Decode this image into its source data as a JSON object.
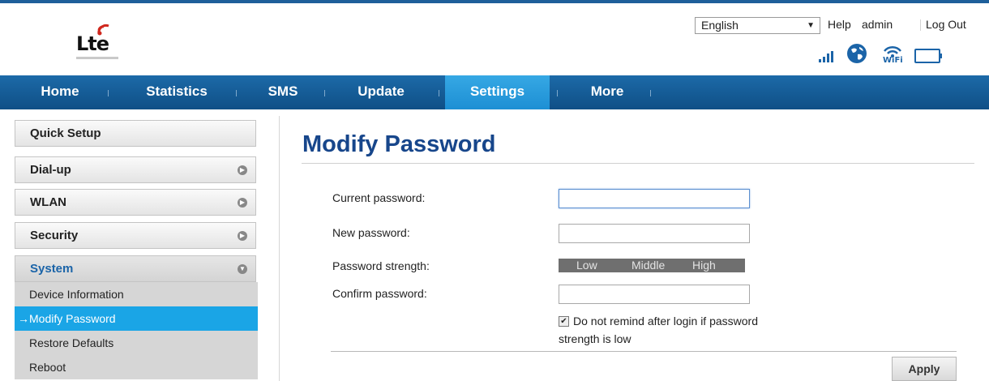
{
  "brand": {
    "logo_text": "Lte",
    "colors": {
      "nav": "#1a62a3",
      "accent": "#1aa5e6",
      "title": "#17468b"
    }
  },
  "header": {
    "language": {
      "selected": "English"
    },
    "links": {
      "help": "Help",
      "user": "admin",
      "logout": "Log Out"
    },
    "status_icons": [
      "signal-strength-icon",
      "globe-icon",
      "wifi-icon",
      "battery-icon"
    ],
    "wifi_label": "WiFi"
  },
  "nav": {
    "items": [
      {
        "label": "Home",
        "active": false
      },
      {
        "label": "Statistics",
        "active": false
      },
      {
        "label": "SMS",
        "active": false
      },
      {
        "label": "Update",
        "active": false
      },
      {
        "label": "Settings",
        "active": true
      },
      {
        "label": "More",
        "active": false
      }
    ]
  },
  "sidebar": {
    "items": [
      {
        "label": "Quick Setup"
      },
      {
        "label": "Dial-up"
      },
      {
        "label": "WLAN"
      },
      {
        "label": "Security"
      },
      {
        "label": "System"
      }
    ],
    "system_sub": [
      {
        "label": "Device Information"
      },
      {
        "label": "→Modify Password"
      },
      {
        "label": "Restore Defaults"
      },
      {
        "label": "Reboot"
      }
    ]
  },
  "content": {
    "title": "Modify Password",
    "labels": {
      "current": "Current password:",
      "new": "New password:",
      "strength": "Password strength:",
      "confirm": "Confirm password:"
    },
    "fields": {
      "current": "",
      "new": "",
      "confirm": ""
    },
    "strength_levels": [
      "Low",
      "Middle",
      "High"
    ],
    "checkbox": {
      "checked": true,
      "label_line1": "Do not remind after login if password",
      "label_line2": "strength is low"
    },
    "apply_label": "Apply"
  }
}
